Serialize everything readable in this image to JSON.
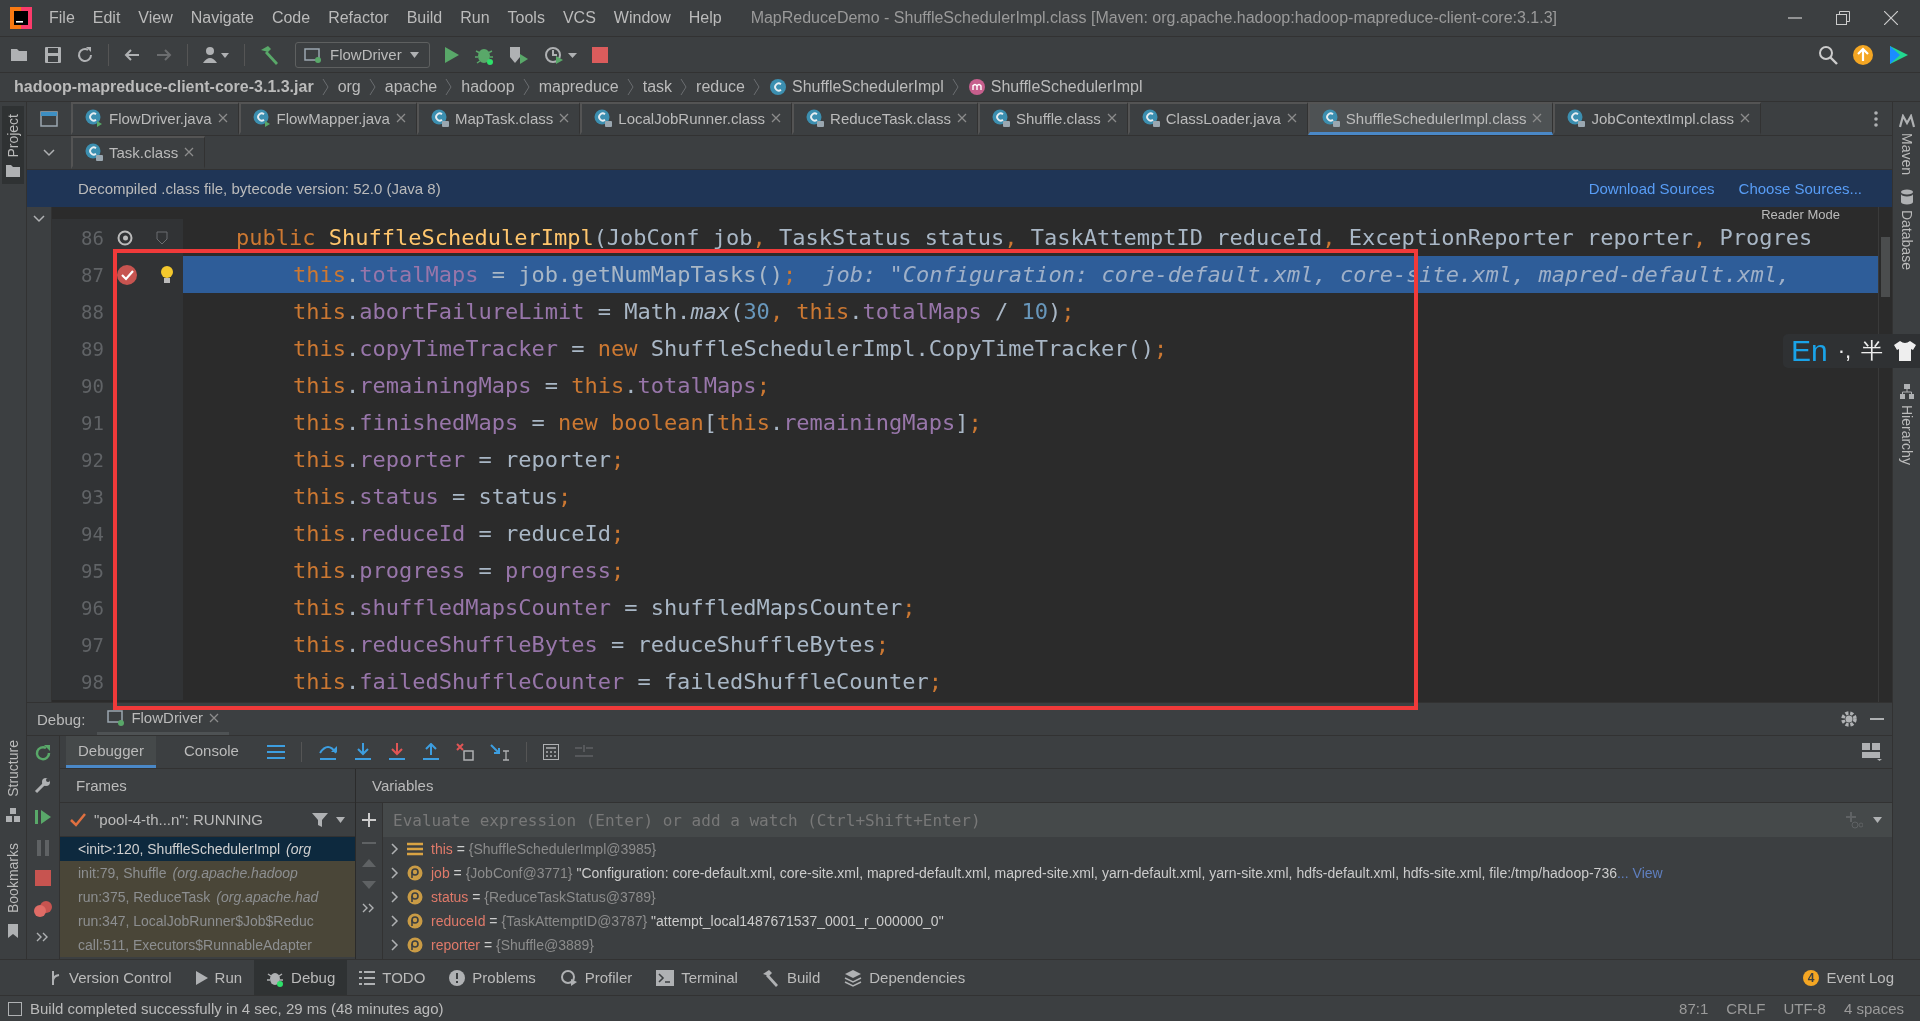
{
  "window": {
    "title": "MapReduceDemo - ShuffleSchedulerImpl.class [Maven: org.apache.hadoop:hadoop-mapreduce-client-core:3.1.3]"
  },
  "menu": [
    "File",
    "Edit",
    "View",
    "Navigate",
    "Code",
    "Refactor",
    "Build",
    "Run",
    "Tools",
    "VCS",
    "Window",
    "Help"
  ],
  "toolbar": {
    "run_config": "FlowDriver"
  },
  "breadcrumbs": [
    {
      "label": "hadoop-mapreduce-client-core-3.1.3.jar",
      "kind": "jar"
    },
    {
      "label": "org",
      "kind": "package"
    },
    {
      "label": "apache",
      "kind": "package"
    },
    {
      "label": "hadoop",
      "kind": "package"
    },
    {
      "label": "mapreduce",
      "kind": "package"
    },
    {
      "label": "task",
      "kind": "package"
    },
    {
      "label": "reduce",
      "kind": "package"
    },
    {
      "label": "ShuffleSchedulerImpl",
      "kind": "class"
    },
    {
      "label": "ShuffleSchedulerImpl",
      "kind": "method"
    }
  ],
  "left_tool_windows": {
    "top": [
      "Project"
    ],
    "bottom": [
      "Structure",
      "Bookmarks"
    ]
  },
  "right_tool_windows": [
    "Maven",
    "Database",
    "Hierarchy"
  ],
  "editor_tabs": [
    [
      {
        "label": "FlowDriver.java",
        "kind": "java",
        "selected": false
      },
      {
        "label": "FlowMapper.java",
        "kind": "java",
        "selected": false
      },
      {
        "label": "MapTask.class",
        "kind": "class",
        "selected": false
      },
      {
        "label": "LocalJobRunner.class",
        "kind": "class",
        "selected": false
      },
      {
        "label": "ReduceTask.class",
        "kind": "class",
        "selected": false
      },
      {
        "label": "Shuffle.class",
        "kind": "class",
        "selected": false
      },
      {
        "label": "ClassLoader.java",
        "kind": "class",
        "selected": false
      },
      {
        "label": "ShuffleSchedulerImpl.class",
        "kind": "class",
        "selected": true
      },
      {
        "label": "JobContextImpl.class",
        "kind": "class",
        "selected": false
      }
    ],
    [
      {
        "label": "Task.class",
        "kind": "class",
        "selected": false
      }
    ]
  ],
  "banner": {
    "text": "Decompiled .class file, bytecode version: 52.0 (Java 8)",
    "links": [
      "Download Sources",
      "Choose Sources..."
    ]
  },
  "editor": {
    "reader_mode": "Reader Mode",
    "lines": [
      {
        "number": "86",
        "kind": "declaration",
        "current": false,
        "breakpoint": false,
        "tokens": [
          {
            "kind": "keyword",
            "text": "public "
          },
          {
            "kind": "method",
            "text": "ShuffleSchedulerImpl"
          },
          {
            "kind": "plain",
            "text": "(JobConf job"
          },
          {
            "kind": "keyword",
            "text": ","
          },
          {
            "kind": "plain",
            "text": " TaskStatus status"
          },
          {
            "kind": "keyword",
            "text": ","
          },
          {
            "kind": "plain",
            "text": " TaskAttemptID reduceId"
          },
          {
            "kind": "keyword",
            "text": ","
          },
          {
            "kind": "plain",
            "text": " ExceptionReporter reporter"
          },
          {
            "kind": "keyword",
            "text": ","
          },
          {
            "kind": "plain",
            "text": " Progres"
          }
        ]
      },
      {
        "number": "87",
        "kind": "statement",
        "current": true,
        "breakpoint": true,
        "hint": "job: \"Configuration: core-default.xml, core-site.xml, mapred-default.xml,",
        "tokens": [
          {
            "kind": "keyword",
            "text": "this"
          },
          {
            "kind": "plain",
            "text": "."
          },
          {
            "kind": "field",
            "text": "totalMaps"
          },
          {
            "kind": "plain",
            "text": " = job.getNumMapTasks()"
          },
          {
            "kind": "keyword",
            "text": ";"
          }
        ]
      },
      {
        "number": "88",
        "kind": "statement",
        "current": false,
        "breakpoint": false,
        "tokens": [
          {
            "kind": "keyword",
            "text": "this"
          },
          {
            "kind": "plain",
            "text": "."
          },
          {
            "kind": "field",
            "text": "abortFailureLimit"
          },
          {
            "kind": "plain",
            "text": " = Math."
          },
          {
            "kind": "static",
            "text": "max"
          },
          {
            "kind": "plain",
            "text": "("
          },
          {
            "kind": "number",
            "text": "30"
          },
          {
            "kind": "keyword",
            "text": ", this"
          },
          {
            "kind": "plain",
            "text": "."
          },
          {
            "kind": "field",
            "text": "totalMaps"
          },
          {
            "kind": "plain",
            "text": " / "
          },
          {
            "kind": "number",
            "text": "10"
          },
          {
            "kind": "plain",
            "text": ")"
          },
          {
            "kind": "keyword",
            "text": ";"
          }
        ]
      },
      {
        "number": "89",
        "kind": "statement",
        "current": false,
        "breakpoint": false,
        "tokens": [
          {
            "kind": "keyword",
            "text": "this"
          },
          {
            "kind": "plain",
            "text": "."
          },
          {
            "kind": "field",
            "text": "copyTimeTracker"
          },
          {
            "kind": "plain",
            "text": " = "
          },
          {
            "kind": "keyword",
            "text": "new"
          },
          {
            "kind": "plain",
            "text": " ShuffleSchedulerImpl.CopyTimeTracker()"
          },
          {
            "kind": "keyword",
            "text": ";"
          }
        ]
      },
      {
        "number": "90",
        "kind": "statement",
        "current": false,
        "breakpoint": false,
        "tokens": [
          {
            "kind": "keyword",
            "text": "this"
          },
          {
            "kind": "plain",
            "text": "."
          },
          {
            "kind": "field",
            "text": "remainingMaps"
          },
          {
            "kind": "plain",
            "text": " = "
          },
          {
            "kind": "keyword",
            "text": "this"
          },
          {
            "kind": "plain",
            "text": "."
          },
          {
            "kind": "field",
            "text": "totalMaps"
          },
          {
            "kind": "keyword",
            "text": ";"
          }
        ]
      },
      {
        "number": "91",
        "kind": "statement",
        "current": false,
        "breakpoint": false,
        "tokens": [
          {
            "kind": "keyword",
            "text": "this"
          },
          {
            "kind": "plain",
            "text": "."
          },
          {
            "kind": "field",
            "text": "finishedMaps"
          },
          {
            "kind": "plain",
            "text": " = "
          },
          {
            "kind": "keyword",
            "text": "new boolean"
          },
          {
            "kind": "plain",
            "text": "["
          },
          {
            "kind": "keyword",
            "text": "this"
          },
          {
            "kind": "plain",
            "text": "."
          },
          {
            "kind": "field",
            "text": "remainingMaps"
          },
          {
            "kind": "plain",
            "text": "]"
          },
          {
            "kind": "keyword",
            "text": ";"
          }
        ]
      },
      {
        "number": "92",
        "kind": "statement",
        "current": false,
        "breakpoint": false,
        "tokens": [
          {
            "kind": "keyword",
            "text": "this"
          },
          {
            "kind": "plain",
            "text": "."
          },
          {
            "kind": "field",
            "text": "reporter"
          },
          {
            "kind": "plain",
            "text": " = reporter"
          },
          {
            "kind": "keyword",
            "text": ";"
          }
        ]
      },
      {
        "number": "93",
        "kind": "statement",
        "current": false,
        "breakpoint": false,
        "tokens": [
          {
            "kind": "keyword",
            "text": "this"
          },
          {
            "kind": "plain",
            "text": "."
          },
          {
            "kind": "field",
            "text": "status"
          },
          {
            "kind": "plain",
            "text": " = status"
          },
          {
            "kind": "keyword",
            "text": ";"
          }
        ]
      },
      {
        "number": "94",
        "kind": "statement",
        "current": false,
        "breakpoint": false,
        "tokens": [
          {
            "kind": "keyword",
            "text": "this"
          },
          {
            "kind": "plain",
            "text": "."
          },
          {
            "kind": "field",
            "text": "reduceId"
          },
          {
            "kind": "plain",
            "text": " = reduceId"
          },
          {
            "kind": "keyword",
            "text": ";"
          }
        ]
      },
      {
        "number": "95",
        "kind": "statement",
        "current": false,
        "breakpoint": false,
        "tokens": [
          {
            "kind": "keyword",
            "text": "this"
          },
          {
            "kind": "plain",
            "text": "."
          },
          {
            "kind": "field",
            "text": "progress"
          },
          {
            "kind": "plain",
            "text": " = "
          },
          {
            "kind": "field",
            "text": "progress"
          },
          {
            "kind": "keyword",
            "text": ";"
          }
        ]
      },
      {
        "number": "96",
        "kind": "statement",
        "current": false,
        "breakpoint": false,
        "tokens": [
          {
            "kind": "keyword",
            "text": "this"
          },
          {
            "kind": "plain",
            "text": "."
          },
          {
            "kind": "field",
            "text": "shuffledMapsCounter"
          },
          {
            "kind": "plain",
            "text": " = shuffledMapsCounter"
          },
          {
            "kind": "keyword",
            "text": ";"
          }
        ]
      },
      {
        "number": "97",
        "kind": "statement",
        "current": false,
        "breakpoint": false,
        "tokens": [
          {
            "kind": "keyword",
            "text": "this"
          },
          {
            "kind": "plain",
            "text": "."
          },
          {
            "kind": "field",
            "text": "reduceShuffleBytes"
          },
          {
            "kind": "plain",
            "text": " = reduceShuffleBytes"
          },
          {
            "kind": "keyword",
            "text": ";"
          }
        ]
      },
      {
        "number": "98",
        "kind": "statement",
        "current": false,
        "breakpoint": false,
        "tokens": [
          {
            "kind": "keyword",
            "text": "this"
          },
          {
            "kind": "plain",
            "text": "."
          },
          {
            "kind": "field",
            "text": "failedShuffleCounter"
          },
          {
            "kind": "plain",
            "text": " = failedShuffleCounter"
          },
          {
            "kind": "keyword",
            "text": ";"
          }
        ]
      }
    ]
  },
  "input_method": {
    "language": "En",
    "punctuation": "·,",
    "width": "半"
  },
  "debug": {
    "label": "Debug:",
    "session": "FlowDriver",
    "tabs": [
      {
        "label": "Debugger",
        "selected": true
      },
      {
        "label": "Console",
        "selected": false
      }
    ],
    "frames_title": "Frames",
    "variables_title": "Variables",
    "thread": "\"pool-4-th...n\": RUNNING",
    "frames": [
      {
        "text": "<init>:120, ShuffleSchedulerImpl *(org*",
        "selected": true
      },
      {
        "text": "init:79, Shuffle *(org.apache.hadoop*",
        "selected": false
      },
      {
        "text": "run:375, ReduceTask *(org.apache.had*",
        "selected": false
      },
      {
        "text": "run:347, LocalJobRunner$Job$Reduc",
        "selected": false
      },
      {
        "text": "call:511, Executors$RunnableAdapter",
        "selected": false
      }
    ],
    "evaluate_placeholder": "Evaluate expression (Enter) or add a watch (Ctrl+Shift+Enter)",
    "variables": [
      {
        "kind": "object",
        "name": "this",
        "operator": "=",
        "ref": "{ShuffleSchedulerImpl@3985}"
      },
      {
        "kind": "parameter",
        "name": "job",
        "operator": "=",
        "ref": "{JobConf@3771}",
        "value": "\"Configuration: core-default.xml, core-site.xml, mapred-default.xml, mapred-site.xml, yarn-default.xml, yarn-site.xml, hdfs-default.xml, hdfs-site.xml, file:/tmp/hadoop-736",
        "link": "... View"
      },
      {
        "kind": "parameter",
        "name": "status",
        "operator": "=",
        "ref": "{ReduceTaskStatus@3789}"
      },
      {
        "kind": "parameter",
        "name": "reduceId",
        "operator": "=",
        "ref": "{TaskAttemptID@3787}",
        "value": "\"attempt_local1487671537_0001_r_000000_0\""
      },
      {
        "kind": "parameter",
        "name": "reporter",
        "operator": "=",
        "ref": "{Shuffle@3889}"
      }
    ]
  },
  "tool_windows": [
    {
      "label": "Version Control",
      "kind": "vcs",
      "selected": false
    },
    {
      "label": "Run",
      "kind": "run",
      "selected": false
    },
    {
      "label": "Debug",
      "kind": "debug",
      "selected": true
    },
    {
      "label": "TODO",
      "kind": "todo",
      "selected": false
    },
    {
      "label": "Problems",
      "kind": "problems",
      "selected": false
    },
    {
      "label": "Profiler",
      "kind": "profiler",
      "selected": false
    },
    {
      "label": "Terminal",
      "kind": "terminal",
      "selected": false
    },
    {
      "label": "Build",
      "kind": "build",
      "selected": false
    },
    {
      "label": "Dependencies",
      "kind": "dependencies",
      "selected": false
    }
  ],
  "event_log": {
    "label": "Event Log",
    "count": "4"
  },
  "status_bar": {
    "message": "Build completed successfully in 4 sec, 29 ms (48 minutes ago)",
    "items": [
      "87:1",
      "CRLF",
      "UTF-8",
      "4 spaces"
    ]
  }
}
